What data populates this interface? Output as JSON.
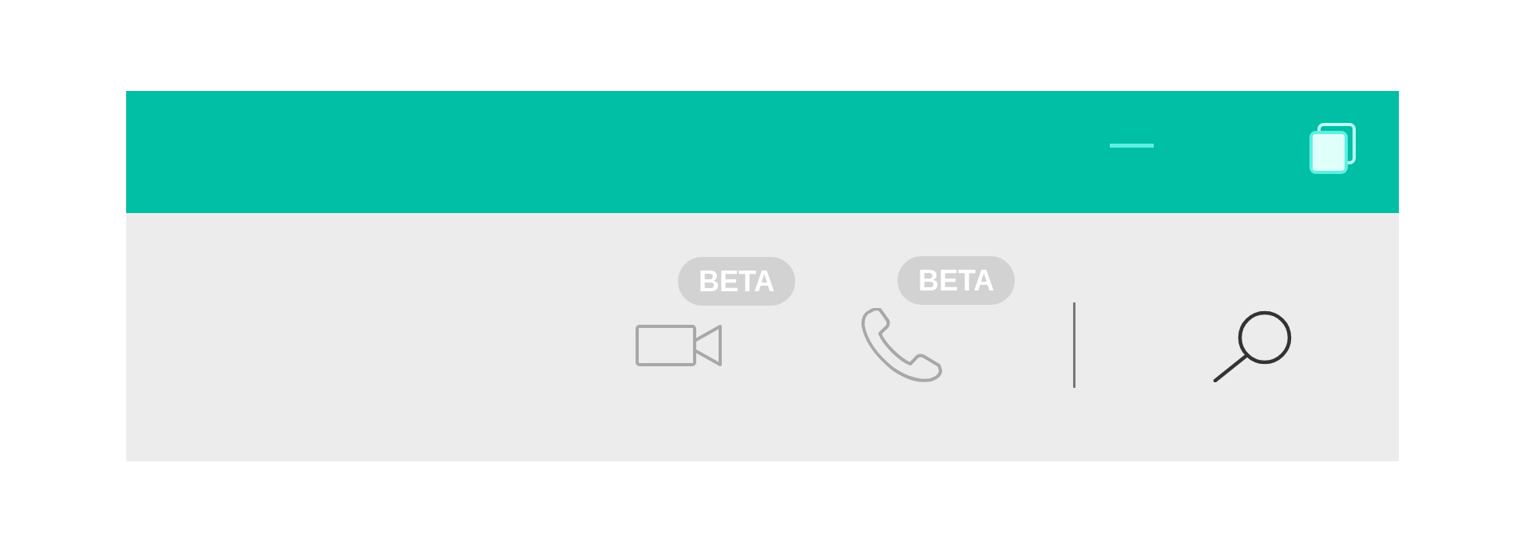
{
  "toolbar": {
    "actions": [
      {
        "kind": "video",
        "badge": "BETA"
      },
      {
        "kind": "phone",
        "badge": "BETA"
      },
      {
        "kind": "divider"
      },
      {
        "kind": "search"
      }
    ]
  }
}
